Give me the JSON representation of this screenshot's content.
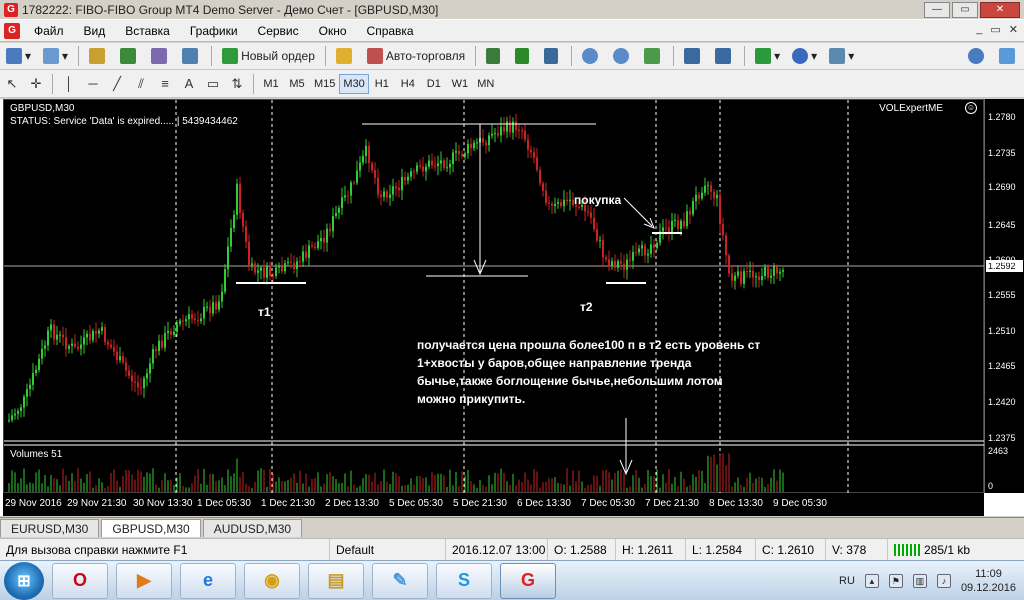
{
  "window": {
    "app_icon": "mt4-icon",
    "title": "1782222: FIBO-FIBO Group MT4 Demo Server - Демо Счет - [GBPUSD,M30]",
    "controls": {
      "minimize": "—",
      "maximize": "▭",
      "close": "✕"
    }
  },
  "menu": {
    "items": [
      "Файл",
      "Вид",
      "Вставка",
      "Графики",
      "Сервис",
      "Окно",
      "Справка"
    ],
    "right_controls": [
      "_",
      "▭",
      "✕"
    ]
  },
  "toolbar": {
    "new_order_label": "Новый ордер",
    "autotrading_label": "Авто-торговля",
    "timeframes": [
      "M1",
      "M5",
      "M15",
      "M30",
      "H1",
      "H4",
      "D1",
      "W1",
      "MN"
    ],
    "active_timeframe": "M30"
  },
  "chart": {
    "symbol_header": "GBPUSD,M30",
    "status": "STATUS:  Service 'Data' is expired.....  |  5439434462",
    "ea_name": "VOLExpertME",
    "price_levels": [
      "1.2780",
      "1.2735",
      "1.2690",
      "1.2645",
      "1.2600",
      "1.2555",
      "1.2510",
      "1.2465",
      "1.2420",
      "1.2375"
    ],
    "current_price": "1.2592",
    "time_labels": [
      "29 Nov 2016",
      "29 Nov 21:30",
      "30 Nov 13:30",
      "1 Dec 05:30",
      "1 Dec 21:30",
      "2 Dec 13:30",
      "5 Dec 05:30",
      "5 Dec 21:30",
      "6 Dec 13:30",
      "7 Dec 05:30",
      "7 Dec 21:30",
      "8 Dec 13:30",
      "9 Dec 05:30"
    ],
    "annotation_t1": "т1",
    "annotation_t2": "т2",
    "annotation_buy": "покупка",
    "comment_lines": [
      "получается цена прошла более100 п в т2 есть уровень ст",
      "1+хвосты у баров,общее направление тренда",
      "бычье,также боглощение бычье,небольшим лотом",
      "можно прикупить."
    ],
    "volumes_label": "Volumes 51",
    "volume_scale_top": "2463",
    "volume_scale_bottom": "0",
    "colors": {
      "background": "#000000",
      "bull": "#33cc33",
      "bear": "#cc2222",
      "grid": "#ffffff",
      "text": "#ffffff"
    }
  },
  "tabs": {
    "items": [
      "EURUSD,M30",
      "GBPUSD,M30",
      "AUDUSD,M30"
    ],
    "active": "GBPUSD,M30"
  },
  "status_bar": {
    "help": "Для вызова справки нажмите F1",
    "profile": "Default",
    "datetime": "2016.12.07 13:00",
    "open": "O: 1.2588",
    "high": "H: 1.2611",
    "low": "L: 1.2584",
    "close": "C: 1.2610",
    "volume": "V: 378",
    "traffic": "285/1 kb"
  },
  "taskbar": {
    "apps": [
      "opera-icon",
      "media-player-icon",
      "internet-explorer-icon",
      "chrome-icon",
      "file-explorer-icon",
      "paint-icon",
      "skype-icon",
      "fibo-group-icon"
    ],
    "language": "RU",
    "time": "11:09",
    "date": "09.12.2016"
  }
}
